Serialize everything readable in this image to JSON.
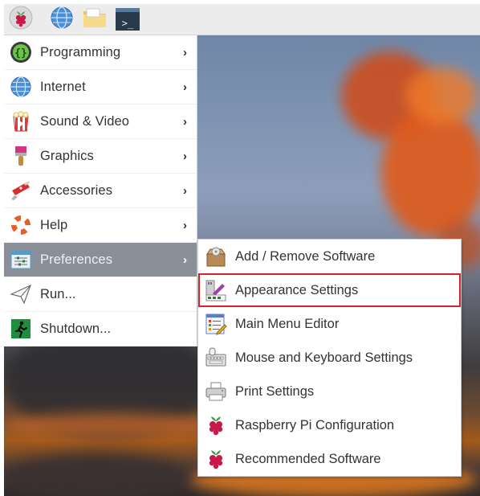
{
  "taskbar": {
    "buttons": [
      {
        "name": "raspberry-menu-button",
        "icon": "raspberry-icon"
      },
      {
        "name": "web-browser-button",
        "icon": "globe-icon"
      },
      {
        "name": "file-manager-button",
        "icon": "folder-icon"
      },
      {
        "name": "terminal-button",
        "icon": "terminal-icon",
        "glyph": ">_"
      }
    ]
  },
  "menu": {
    "items": [
      {
        "label": "Programming",
        "icon": "programming-icon",
        "has_submenu": true
      },
      {
        "label": "Internet",
        "icon": "globe-icon",
        "has_submenu": true
      },
      {
        "label": "Sound & Video",
        "icon": "popcorn-icon",
        "has_submenu": true
      },
      {
        "label": "Graphics",
        "icon": "paintbrush-icon",
        "has_submenu": true
      },
      {
        "label": "Accessories",
        "icon": "swiss-knife-icon",
        "has_submenu": true
      },
      {
        "label": "Help",
        "icon": "lifebuoy-icon",
        "has_submenu": true
      },
      {
        "label": "Preferences",
        "icon": "preferences-icon",
        "has_submenu": true,
        "active": true
      },
      {
        "label": "Run...",
        "icon": "paper-plane-icon",
        "has_submenu": false
      },
      {
        "label": "Shutdown...",
        "icon": "exit-icon",
        "has_submenu": false
      }
    ],
    "arrow_glyph": "›"
  },
  "submenu": {
    "parent": "Preferences",
    "items": [
      {
        "label": "Add / Remove Software",
        "icon": "package-icon"
      },
      {
        "label": "Appearance Settings",
        "icon": "appearance-icon",
        "highlighted": true
      },
      {
        "label": "Main Menu Editor",
        "icon": "menu-editor-icon"
      },
      {
        "label": "Mouse and Keyboard Settings",
        "icon": "keyboard-mouse-icon"
      },
      {
        "label": "Print Settings",
        "icon": "printer-icon"
      },
      {
        "label": "Raspberry Pi Configuration",
        "icon": "raspberry-icon"
      },
      {
        "label": "Recommended Software",
        "icon": "raspberry-icon"
      }
    ]
  },
  "colors": {
    "active_item": "#8a8f9a",
    "highlight_border": "#d8222a",
    "raspberry_red": "#c51a4a"
  }
}
